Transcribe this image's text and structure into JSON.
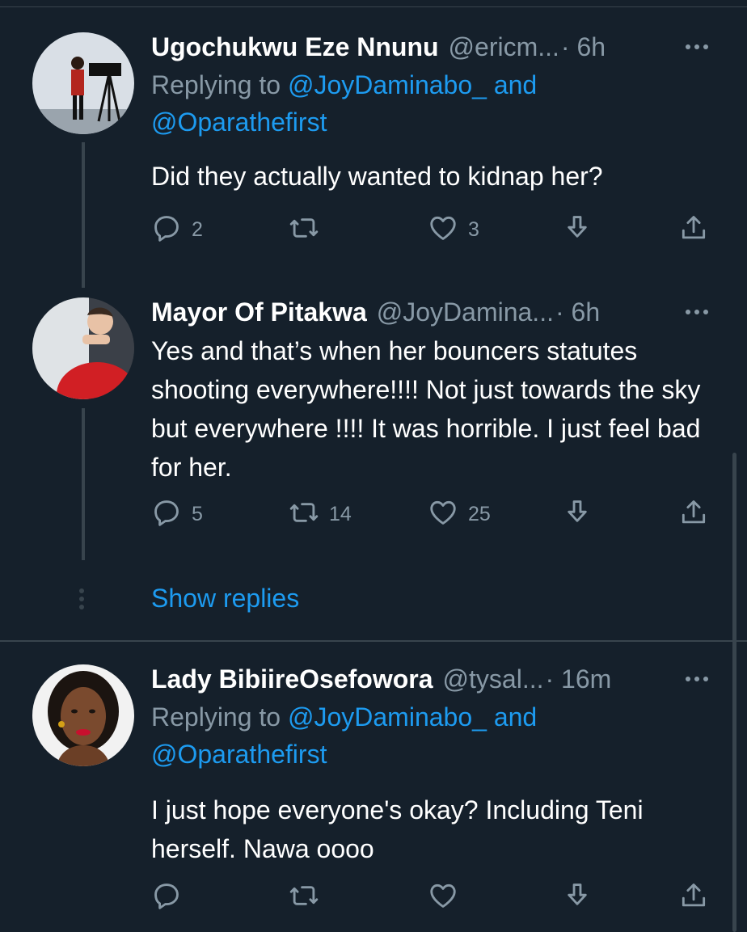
{
  "colors": {
    "background": "#15202b",
    "text": "#ffffff",
    "secondary": "#8899a6",
    "link": "#1d9bf0",
    "line": "#38444d"
  },
  "tweets": [
    {
      "name": "Ugochukwu Eze Nnunu",
      "handle": "@ericm...",
      "time": "· 6h",
      "replying_prefix": "Replying to ",
      "mention1": "@JoyDaminabo_",
      "conjunction": " and",
      "mention2": "@Oparathefirst",
      "text": "Did they actually wanted to kidnap her?",
      "replies": "2",
      "retweets": "",
      "likes": "3",
      "icons": [
        "reply-icon",
        "retweet-icon",
        "like-icon",
        "download-icon",
        "share-icon"
      ]
    },
    {
      "name": "Mayor Of Pitakwa",
      "handle": "@JoyDamina...",
      "time": "· 6h",
      "text": "Yes and that’s when her bouncers statutes shooting everywhere!!!! Not just towards the sky but everywhere !!!! It was horrible. I just feel bad for her.",
      "replies": "5",
      "retweets": "14",
      "likes": "25",
      "icons": [
        "reply-icon",
        "retweet-icon",
        "like-icon",
        "download-icon",
        "share-icon"
      ]
    },
    {
      "name": "Lady BibiireOsefowora",
      "handle": "@tysal...",
      "time": "· 16m",
      "replying_prefix": "Replying to ",
      "mention1": "@JoyDaminabo_",
      "conjunction": " and",
      "mention2": "@Oparathefirst",
      "text": "I just hope everyone's okay? Including Teni herself. Nawa oooo",
      "replies": "",
      "retweets": "",
      "likes": "",
      "icons": [
        "reply-icon",
        "retweet-icon",
        "like-icon",
        "download-icon",
        "share-icon"
      ]
    }
  ],
  "show_replies": "Show replies"
}
